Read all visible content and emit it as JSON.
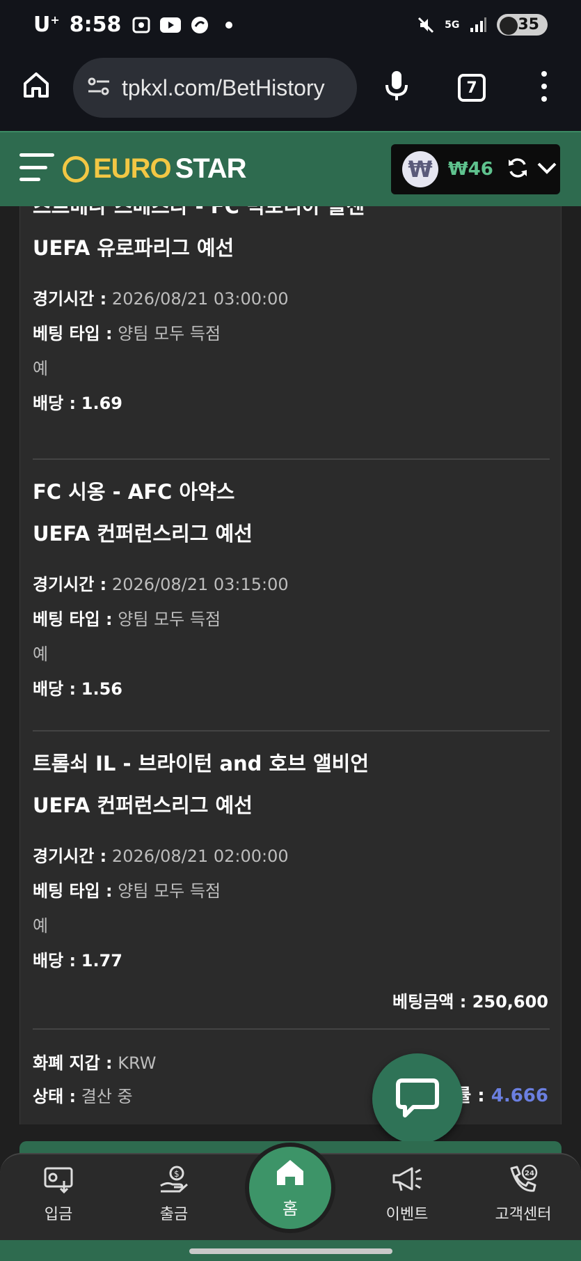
{
  "status_bar": {
    "carrier": "U",
    "carrier_sup": "+",
    "time": "8:58",
    "network": "5G",
    "battery": "35"
  },
  "browser": {
    "url": "tpkxl.com/BetHistory",
    "tab_count": "7"
  },
  "header": {
    "logo_euro": "EURO",
    "logo_star": "STAR",
    "won_symbol": "₩",
    "balance": "₩46"
  },
  "bets": [
    {
      "match": "츠르베나 즈베즈다 - FC 빅토리아 플젠",
      "league": "UEFA 유로파리그 예선",
      "time_label": "경기시간 :",
      "time_value": "2026/08/21 03:00:00",
      "type_label": "베팅 타입 :",
      "type_value": "양팀 모두 득점",
      "selection": "예",
      "odds_label": "배당 :",
      "odds_value": "1.69"
    },
    {
      "match": "FC 시옹 - AFC 아약스",
      "league": "UEFA 컨퍼런스리그 예선",
      "time_label": "경기시간 :",
      "time_value": "2026/08/21 03:15:00",
      "type_label": "베팅 타입 :",
      "type_value": "양팀 모두 득점",
      "selection": "예",
      "odds_label": "배당 :",
      "odds_value": "1.56"
    },
    {
      "match": "트롬쇠 IL - 브라이턴 and 호브 앨비언",
      "league": "UEFA 컨퍼런스리그 예선",
      "time_label": "경기시간 :",
      "time_value": "2026/08/21 02:00:00",
      "type_label": "베팅 타입 :",
      "type_value": "양팀 모두 득점",
      "selection": "예",
      "odds_label": "배당 :",
      "odds_value": "1.77"
    }
  ],
  "summary": {
    "amount_label": "베팅금액 :",
    "amount_value": "250,600",
    "currency_label": "화폐 지갑 :",
    "currency_value": "KRW",
    "status_label": "상태 :",
    "status_value": "결산 중",
    "total_odds_label": "률 :",
    "total_odds_value": "4.666"
  },
  "bottom_nav": {
    "deposit": "입금",
    "withdraw": "출금",
    "home": "홈",
    "event": "이벤트",
    "support": "고객센터"
  }
}
